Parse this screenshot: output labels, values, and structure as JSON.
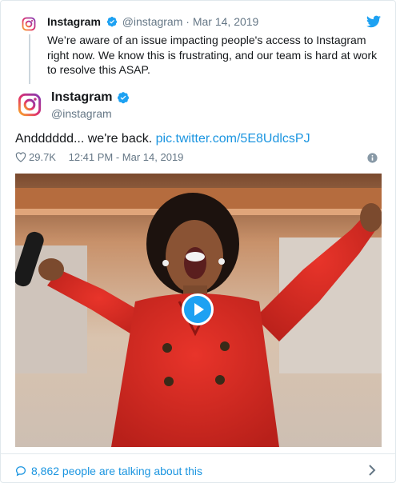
{
  "quoted": {
    "name": "Instagram",
    "handle": "@instagram",
    "dot": "·",
    "date": "Mar 14, 2019",
    "text": "We’re aware of an issue impacting people's access to Instagram right now. We know this is frustrating, and our team is hard at work to resolve this ASAP."
  },
  "tweet": {
    "name": "Instagram",
    "handle": "@instagram",
    "text": "Andddddd... we're back. ",
    "link": "pic.twitter.com/5E8UdlcsPJ",
    "likes": "29.7K",
    "timestamp": "12:41 PM - Mar 14, 2019"
  },
  "footer": {
    "talking": "8,862 people are talking about this"
  },
  "icons": {
    "brand_bird": "twitter-bird-icon",
    "verified": "verified-badge-icon",
    "like": "heart-icon",
    "info": "info-icon",
    "play": "play-icon",
    "reply": "speech-bubble-icon",
    "chevron": "chevron-right-icon"
  },
  "colors": {
    "link": "#1b95e0",
    "muted": "#657786",
    "text": "#14171a",
    "border": "#e1e8ed"
  }
}
